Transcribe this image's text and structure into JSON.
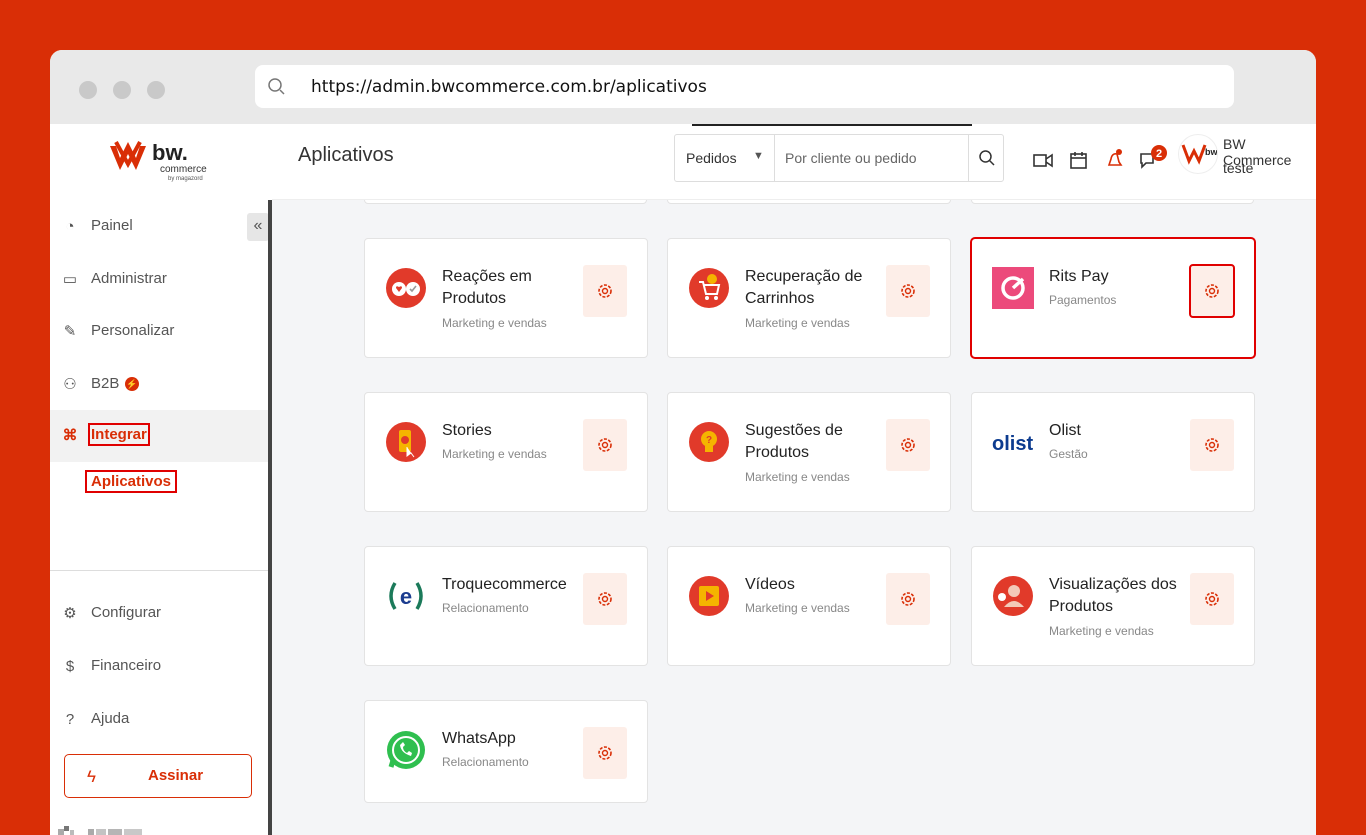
{
  "browser": {
    "url": "https://admin.bwcommerce.com.br/aplicativos"
  },
  "brand": {
    "name": "bw.",
    "sub": "commerce",
    "by": "by magazord"
  },
  "sidebar": {
    "collapse": "«",
    "items": [
      {
        "label": "Painel",
        "icon": "dashboard-icon"
      },
      {
        "label": "Administrar",
        "icon": "monitor-icon"
      },
      {
        "label": "Personalizar",
        "icon": "pencil-icon"
      },
      {
        "label": "B2B",
        "icon": "users-icon"
      },
      {
        "label": "Integrar",
        "icon": "command-icon"
      },
      {
        "label": "Configurar",
        "icon": "gear-icon"
      },
      {
        "label": "Financeiro",
        "icon": "dollar-icon"
      },
      {
        "label": "Ajuda",
        "icon": "help-icon"
      }
    ],
    "sub_item": "Aplicativos",
    "cta": "Assinar"
  },
  "topbar": {
    "title": "Aplicativos",
    "search_select": "Pedidos",
    "search_placeholder": "Por cliente ou pedido",
    "messages_badge": "2",
    "user_name": "BW Commerce",
    "user_store": "teste"
  },
  "apps": [
    {
      "name": "Reações em Produtos",
      "category": "Marketing e vendas",
      "icon": "reactions-icon"
    },
    {
      "name": "Recuperação de Carrinhos",
      "category": "Marketing e vendas",
      "icon": "cart-recovery-icon"
    },
    {
      "name": "Rits Pay",
      "category": "Pagamentos",
      "icon": "rits-pay-logo"
    },
    {
      "name": "Stories",
      "category": "Marketing e vendas",
      "icon": "stories-icon"
    },
    {
      "name": "Sugestões de Produtos",
      "category": "Marketing e vendas",
      "icon": "lightbulb-icon"
    },
    {
      "name": "Olist",
      "category": "Gestão",
      "icon": "olist-logo",
      "logo_text": "olist"
    },
    {
      "name": "Troquecommerce",
      "category": "Relacionamento",
      "icon": "troquecommerce-logo"
    },
    {
      "name": "Vídeos",
      "category": "Marketing e vendas",
      "icon": "video-icon"
    },
    {
      "name": "Visualizações dos Produtos",
      "category": "Marketing e vendas",
      "icon": "views-icon"
    },
    {
      "name": "WhatsApp",
      "category": "Relacionamento",
      "icon": "whatsapp-icon"
    }
  ],
  "colors": {
    "accent": "#d92e06",
    "highlight": "#e00000",
    "gear_bg": "#fdeee8"
  }
}
